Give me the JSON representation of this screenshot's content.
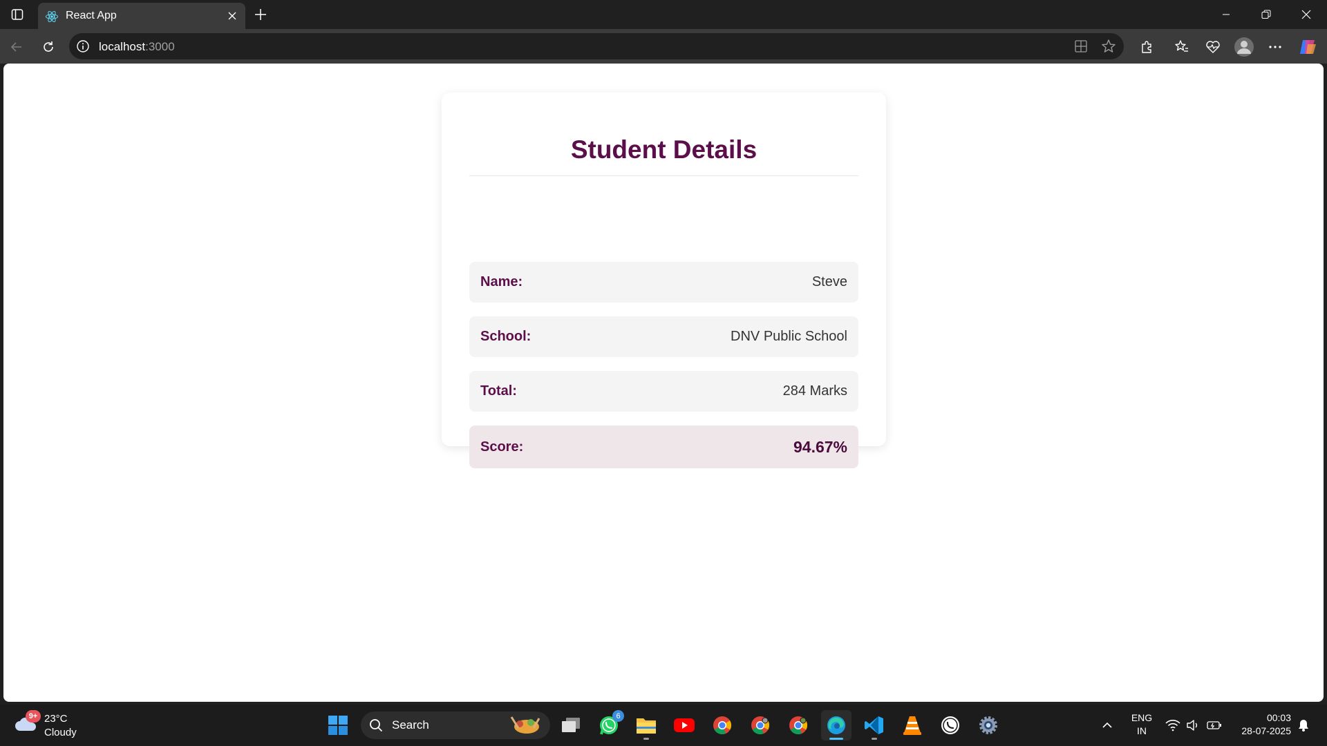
{
  "browser": {
    "tab_title": "React App",
    "url_host": "localhost",
    "url_port": ":3000",
    "icons": {
      "sidebar": "tab-actions-icon",
      "favicon": "react-icon",
      "close": "close-icon",
      "new_tab": "plus-icon",
      "minimize": "minimize-icon",
      "restore": "restore-icon",
      "window_close": "close-icon",
      "back": "back-arrow-icon",
      "reload": "reload-icon",
      "site_info": "info-icon",
      "app_available": "apps-icon",
      "favorite": "star-icon",
      "extensions": "puzzle-icon",
      "favorites": "favorites-icon",
      "health": "heart-pulse-icon",
      "profile": "avatar-icon",
      "more": "more-icon",
      "copilot": "copilot-icon"
    }
  },
  "card": {
    "title": "Student Details",
    "rows": [
      {
        "label": "Name:",
        "value": "Steve"
      },
      {
        "label": "School:",
        "value": "DNV Public School"
      },
      {
        "label": "Total:",
        "value": "284 Marks"
      },
      {
        "label": "Score:",
        "value": "94.67%"
      }
    ],
    "colors": {
      "accent": "#5c0e4a",
      "row_bg": "#f4f4f4",
      "score_bg": "#efe6ea"
    }
  },
  "taskbar": {
    "weather": {
      "temp": "23°C",
      "condition": "Cloudy",
      "badge": "9+"
    },
    "search_placeholder": "Search",
    "whatsapp_badge": "6",
    "language": {
      "line1": "ENG",
      "line2": "IN"
    },
    "clock": {
      "time": "00:03",
      "date": "28-07-2025"
    },
    "apps": [
      "start-icon",
      "task-view-icon",
      "whatsapp-icon",
      "file-explorer-icon",
      "youtube-icon",
      "chrome-icon",
      "chrome-icon",
      "chrome-icon",
      "edge-icon",
      "vscode-icon",
      "vlc-icon",
      "whatsapp-icon",
      "settings-icon"
    ]
  }
}
